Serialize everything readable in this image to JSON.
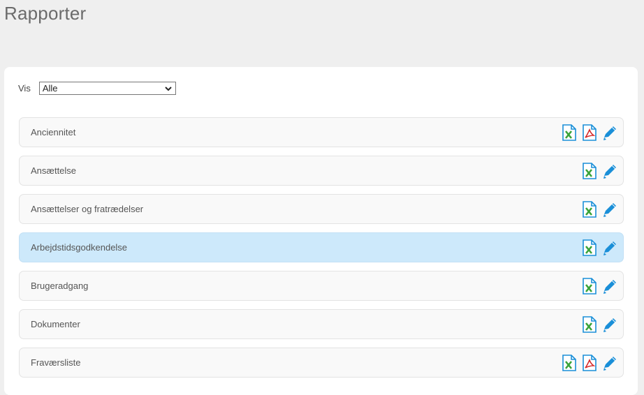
{
  "page": {
    "title": "Rapporter"
  },
  "filter": {
    "label": "Vis",
    "selected": "Alle"
  },
  "reports": [
    {
      "label": "Anciennitet",
      "excel": true,
      "pdf": true,
      "edit": true,
      "active": false
    },
    {
      "label": "Ansættelse",
      "excel": true,
      "pdf": false,
      "edit": true,
      "active": false
    },
    {
      "label": "Ansættelser og fratrædelser",
      "excel": true,
      "pdf": false,
      "edit": true,
      "active": false
    },
    {
      "label": "Arbejdstidsgodkendelse",
      "excel": true,
      "pdf": false,
      "edit": true,
      "active": true
    },
    {
      "label": "Brugeradgang",
      "excel": true,
      "pdf": false,
      "edit": true,
      "active": false
    },
    {
      "label": "Dokumenter",
      "excel": true,
      "pdf": false,
      "edit": true,
      "active": false
    },
    {
      "label": "Fraværsliste",
      "excel": true,
      "pdf": true,
      "edit": true,
      "active": false
    }
  ],
  "icons": {
    "excel": "excel-export-icon",
    "pdf": "pdf-export-icon",
    "edit": "pencil-edit-icon",
    "dropdown": "chevron-down-icon"
  },
  "colors": {
    "page_bg": "#efefef",
    "panel_bg": "#ffffff",
    "row_bg": "#f9f9f9",
    "row_active_bg": "#cde9fb",
    "icon_blue": "#1a8fd8",
    "excel_green": "#3aa33a",
    "pdf_red": "#d62b2b"
  }
}
